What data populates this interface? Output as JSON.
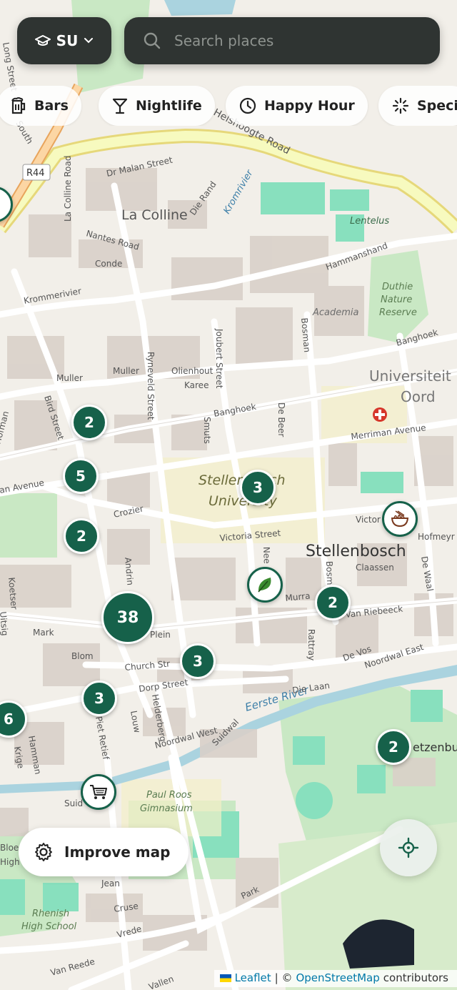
{
  "campus": {
    "label": "SU"
  },
  "search": {
    "placeholder": "Search places"
  },
  "chips": [
    "Bars",
    "Nightlife",
    "Happy Hour",
    "Speci"
  ],
  "map_labels": {
    "area_la_colline": "La Colline",
    "town_stellenbosch": "Stellenbosch",
    "university_line1": "Stellenbosch",
    "university_line2": "University",
    "universiteit_line1": "Universiteit",
    "universiteit_line2": "Oord",
    "duthie_line1": "Duthie",
    "duthie_line2": "Nature",
    "duthie_line3": "Reserve",
    "academia": "Academia",
    "lentelus": "Lentelus",
    "paul_roos_line1": "Paul Roos",
    "paul_roos_line2": "Gimnasium",
    "rhenish_line1": "Rhenish",
    "rhenish_line2": "High School",
    "eerste_river": "Eerste River",
    "kromrivier": "Kromrivier",
    "helshoogte_road": "Helshoogte Road",
    "r44": "R44",
    "streets": {
      "dr_malan": "Dr Malan Street",
      "die_rand": "Die Rand",
      "la_colline_road": "La Colline Road",
      "nantes_road": "Nantes Road",
      "conde": "Conde",
      "krommerivier": "Krommerivier",
      "hammanshand": "Hammanshand",
      "bird_street": "Bird Street",
      "muller1": "Muller",
      "muller2": "Muller",
      "olienhout": "Olienhout",
      "karee": "Karee",
      "joubert": "Joubert Street",
      "ryneveld": "Ryneveld Street",
      "bosman": "Bosman",
      "banghoek": "Banghoek",
      "banghoek2": "Banghoek",
      "de_beer": "De Beer",
      "smuts": "Smuts",
      "merriman": "Merriman Avenue",
      "crozier": "Crozier",
      "victoria": "Victoria Street",
      "victoria2": "Victor",
      "hofmeyr": "Hofmeyr",
      "claassen": "Claassen",
      "murray": "Murra",
      "van_riebeeck": "Van Riebeeck",
      "plein": "Plein",
      "mark": "Mark",
      "blom": "Blom",
      "church": "Church Str",
      "dorp": "Dorp Street",
      "rattray": "Rattray",
      "de_vos": "De Vos",
      "die_laan": "Die Laan",
      "noordwal_east": "Noordwal East",
      "noordwal_west": "Noordwal West",
      "suidwal": "Suidwal",
      "helderberg": "Helderberg",
      "louw": "Louw",
      "piet_retief": "Piet Retief",
      "hamman": "Hamman",
      "krige": "Krige",
      "de_waal": "De Waal",
      "park": "Park",
      "cruse": "Cruse",
      "vrede": "Vrede",
      "van_reede": "Van Reede",
      "van_riebeeck_w": "an Avenue",
      "jean": "Jean",
      "bloe": "Bloe",
      "high": "High",
      "south": "South",
      "long": "Long Street",
      "koetser": "Koetser",
      "uitsig": "Uitsig",
      "hofman": "Hofman",
      "suid": "Suid",
      "etzenbur": "etzenbur",
      "andringa": "Andrin",
      "neethling": "Nee",
      "bosman2": "Bosm",
      "vallen": "Vallen"
    }
  },
  "clusters": [
    {
      "count": "2",
      "size": 48
    },
    {
      "count": "5",
      "size": 48
    },
    {
      "count": "2",
      "size": 48
    },
    {
      "count": "38",
      "size": 72
    },
    {
      "count": "3",
      "size": 48
    },
    {
      "count": "3",
      "size": 48
    },
    {
      "count": "6",
      "size": 48
    },
    {
      "count": "3",
      "size": 48
    },
    {
      "count": "2",
      "size": 48
    },
    {
      "count": "2",
      "size": 48
    }
  ],
  "pois": [
    "noodle-bowl-icon",
    "herb-leaf-icon",
    "shopping-cart-icon",
    "restaurant-icon"
  ],
  "improve_map": {
    "label": "Improve map"
  },
  "attribution": {
    "leaflet": "Leaflet",
    "separator": "| ©",
    "osm": "OpenStreetMap",
    "contributors": "contributors"
  },
  "colors": {
    "accent": "#16614a",
    "panel": "#2f3432",
    "map_bg": "#f2efe9",
    "park": "#c9e8c4",
    "water": "#aad3df"
  }
}
